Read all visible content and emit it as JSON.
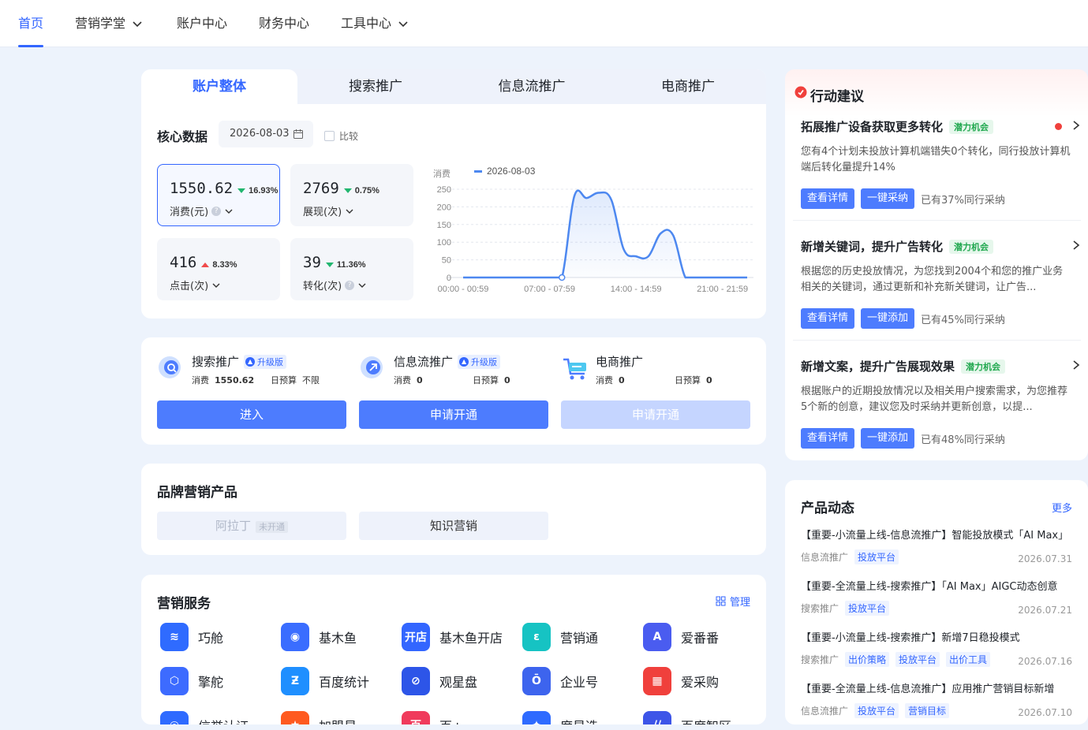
{
  "nav": {
    "items": [
      {
        "label": "首页",
        "active": true,
        "dropdown": false
      },
      {
        "label": "营销学堂",
        "active": false,
        "dropdown": true
      },
      {
        "label": "账户中心",
        "active": false,
        "dropdown": false
      },
      {
        "label": "财务中心",
        "active": false,
        "dropdown": false
      },
      {
        "label": "工具中心",
        "active": false,
        "dropdown": true
      }
    ]
  },
  "account": {
    "tabs": [
      "账户整体",
      "搜索推广",
      "信息流推广",
      "电商推广"
    ],
    "core_title": "核心数据",
    "date": "2026-08-03",
    "compare_label": "比较",
    "metrics": [
      {
        "value": "1550.62",
        "change": "16.93%",
        "direction": "down",
        "label": "消费(元)",
        "help": true
      },
      {
        "value": "2769",
        "change": "0.75%",
        "direction": "down",
        "label": "展现(次)",
        "help": false
      },
      {
        "value": "416",
        "change": "8.33%",
        "direction": "up",
        "label": "点击(次)",
        "help": false
      },
      {
        "value": "39",
        "change": "11.36%",
        "direction": "down",
        "label": "转化(次)",
        "help": true
      }
    ]
  },
  "chart_data": {
    "type": "area",
    "ylabel": "消费",
    "legend": "2026-08-03",
    "ylim": [
      0,
      250
    ],
    "yticks": [
      0,
      50,
      100,
      150,
      200,
      250
    ],
    "xticks": [
      "00:00 - 00:59",
      "07:00 - 07:59",
      "14:00 - 14:59",
      "21:00 - 21:59"
    ],
    "categories": [
      "00",
      "01",
      "02",
      "03",
      "04",
      "05",
      "06",
      "07",
      "08",
      "09",
      "10",
      "11",
      "12",
      "13",
      "14",
      "15",
      "16",
      "17",
      "18",
      "19",
      "20",
      "21",
      "22",
      "23"
    ],
    "series": [
      {
        "name": "2026-08-03",
        "color": "#4d88f0",
        "values": [
          0,
          0,
          0,
          0,
          0,
          0,
          0,
          0,
          0,
          230,
          225,
          240,
          220,
          80,
          60,
          60,
          125,
          120,
          0,
          0,
          0,
          0,
          0,
          0
        ]
      }
    ]
  },
  "promos": [
    {
      "name": "搜索推广",
      "badge": "升级版",
      "spend_label": "消费",
      "spend": "1550.62",
      "budget_label": "日预算",
      "budget": "不限",
      "button": "进入",
      "disabled": false
    },
    {
      "name": "信息流推广",
      "badge": "升级版",
      "spend_label": "消费",
      "spend": "0",
      "budget_label": "日预算",
      "budget": "0",
      "button": "申请开通",
      "disabled": false
    },
    {
      "name": "电商推广",
      "badge": "",
      "spend_label": "消费",
      "spend": "0",
      "budget_label": "日预算",
      "budget": "0",
      "button": "申请开通",
      "disabled": true
    }
  ],
  "brand": {
    "title": "品牌营销产品",
    "items": [
      {
        "label": "阿拉丁",
        "tag": "未开通",
        "disabled": true
      },
      {
        "label": "知识营销",
        "tag": "",
        "disabled": false
      }
    ]
  },
  "services": {
    "title": "营销服务",
    "manage_label": "管理",
    "items": [
      {
        "label": "巧舱",
        "color": "#2f6bff",
        "glyph": "≋"
      },
      {
        "label": "基木鱼",
        "color": "#3a6dff",
        "glyph": "◉"
      },
      {
        "label": "基木鱼开店",
        "color": "#3366ff",
        "glyph": "开店"
      },
      {
        "label": "营销通",
        "color": "#16c3c3",
        "glyph": "ε"
      },
      {
        "label": "爱番番",
        "color": "#4a5cf0",
        "glyph": "A"
      },
      {
        "label": "擎舵",
        "color": "#3d6bff",
        "glyph": "⬡"
      },
      {
        "label": "百度统计",
        "color": "#1f8fff",
        "glyph": "Ƶ"
      },
      {
        "label": "观星盘",
        "color": "#2d55e8",
        "glyph": "⊘"
      },
      {
        "label": "企业号",
        "color": "#3d64ee",
        "glyph": "Ō"
      },
      {
        "label": "爱采购",
        "color": "#f0403c",
        "glyph": "▦"
      },
      {
        "label": "信誉认证",
        "color": "#2f6bff",
        "glyph": "◎"
      },
      {
        "label": "加盟星",
        "color": "#ff5a1f",
        "glyph": "★"
      },
      {
        "label": "百+",
        "color": "#f03b5c",
        "glyph": "百"
      },
      {
        "label": "度星选",
        "color": "#2f6bff",
        "glyph": "✦"
      },
      {
        "label": "百度智区",
        "color": "#3d55e8",
        "glyph": "//"
      }
    ]
  },
  "recommend": {
    "title": "行动建议",
    "items": [
      {
        "title": "拓展推广设备获取更多转化",
        "tag": "潜力机会",
        "dot": true,
        "desc": "您有4个计划未投放计算机端错失0个转化，同行投放计算机端后转化量提升14%",
        "btn1": "查看详情",
        "btn2": "一键采纳",
        "adopt": "已有37%同行采纳"
      },
      {
        "title": "新增关键词，提升广告转化",
        "tag": "潜力机会",
        "dot": false,
        "desc": "根据您的历史投放情况，为您找到2004个和您的推广业务相关的关键词，通过更新和补充新关键词，让广告...",
        "btn1": "查看详情",
        "btn2": "一键添加",
        "adopt": "已有45%同行采纳"
      },
      {
        "title": "新增文案，提升广告展现效果",
        "tag": "潜力机会",
        "dot": false,
        "desc": "根据账户的近期投放情况以及相关用户搜索需求，为您推荐5个新的创意，建议您及时采纳并更新创意，以提...",
        "btn1": "查看详情",
        "btn2": "一键添加",
        "adopt": "已有48%同行采纳"
      }
    ]
  },
  "news": {
    "title": "产品动态",
    "more": "更多",
    "items": [
      {
        "title": "【重要-小流量上线-信息流推广】智能投放模式「AI Max」",
        "source": "信息流推广",
        "tags": [
          "投放平台"
        ],
        "date": "2026.07.31"
      },
      {
        "title": "【重要-全流量上线-搜索推广】「AI Max」AIGC动态创意",
        "source": "搜索推广",
        "tags": [
          "投放平台"
        ],
        "date": "2026.07.21"
      },
      {
        "title": "【重要-小流量上线-搜索推广】新增7日稳投模式",
        "source": "搜索推广",
        "tags": [
          "出价策略",
          "投放平台",
          "出价工具"
        ],
        "date": "2026.07.16"
      },
      {
        "title": "【重要-全流量上线-信息流推广】应用推广营销目标新增",
        "source": "信息流推广",
        "tags": [
          "投放平台",
          "营销目标"
        ],
        "date": "2026.07.10"
      }
    ]
  }
}
